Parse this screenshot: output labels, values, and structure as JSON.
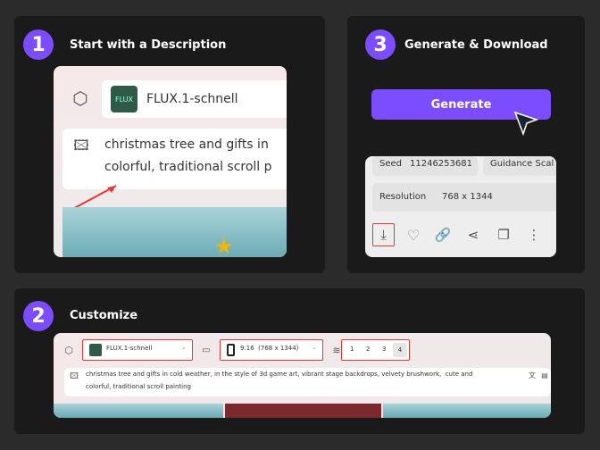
{
  "steps": [
    {
      "number": "1",
      "title": "Start with a Description"
    },
    {
      "number": "2",
      "title": "Customize"
    },
    {
      "number": "3",
      "title": "Generate & Download"
    }
  ],
  "step1": {
    "model": "FLUX.1-schnell",
    "logo": "FLUX",
    "prompt_line1": "christmas tree and gifts in",
    "prompt_line2": "colorful, traditional scroll p"
  },
  "step3": {
    "generate_label": "Generate",
    "seed_label": "Seed",
    "seed_value": "11246253681",
    "guidance_label": "Guidance Scal",
    "resolution_label": "Resolution",
    "resolution_value": "768 x 1344"
  },
  "step2": {
    "model": "FLUX.1-schnell",
    "aspect": "9:16  (768 x 1344)",
    "counts": [
      "1",
      "2",
      "3",
      "4"
    ],
    "selected_count": "4",
    "prompt_line1": "christmas tree and gifts in cold weather, in the style of 3d game art, vibrant stage backdrops, velvety brushwork,  cute and",
    "prompt_line2": "colorful, traditional scroll painting"
  },
  "colors": {
    "accent": "#7c4dff",
    "highlight": "#e53935"
  }
}
